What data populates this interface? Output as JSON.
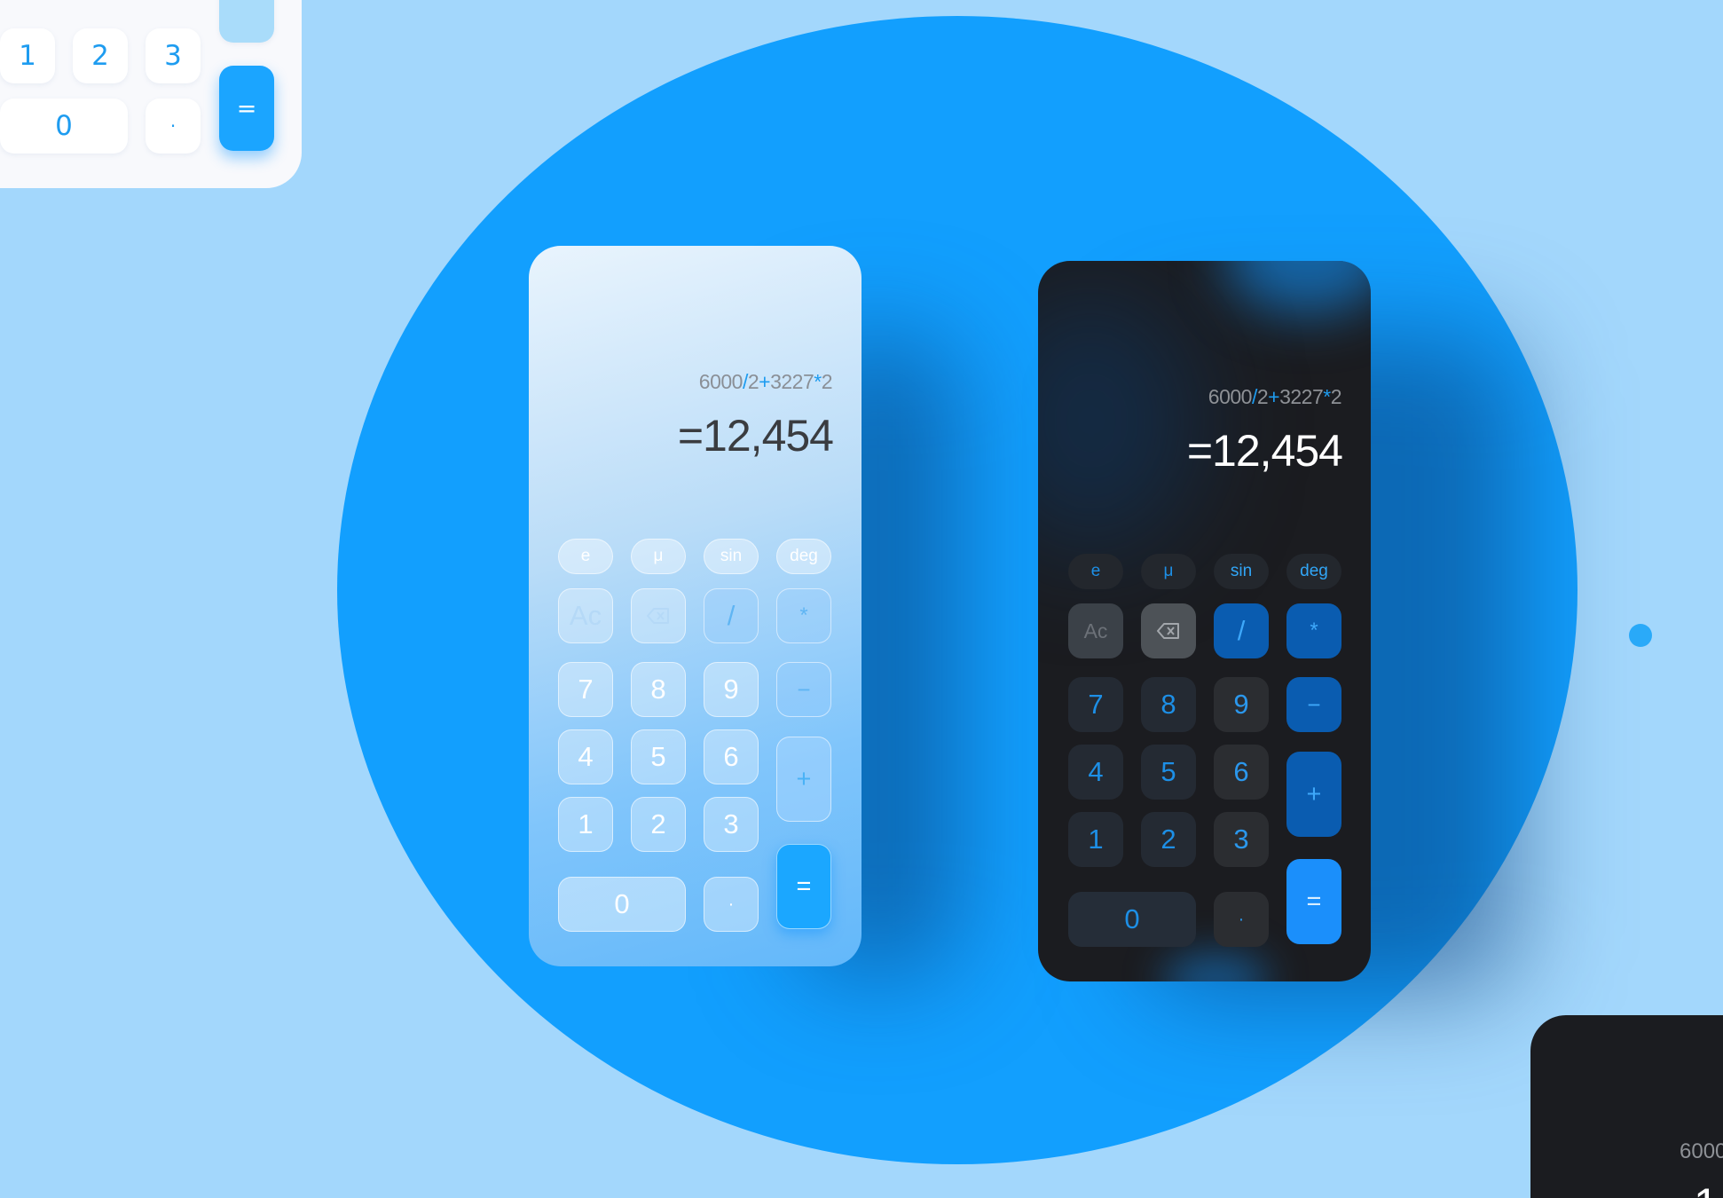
{
  "background_color": "#a3d7fc",
  "accent_color": "#129ffe",
  "top_left_calculator": {
    "keys": [
      "1",
      "2",
      "3",
      "0",
      "·",
      "+",
      "="
    ]
  },
  "light_calculator": {
    "expression": {
      "a": "6000",
      "op1": "/",
      "b": "2",
      "op2": "+",
      "c": "3227",
      "op3": "*",
      "d": "2"
    },
    "result": "=12,454",
    "functions": [
      "e",
      "μ",
      "sin",
      "deg"
    ],
    "controls": {
      "clear": "Ac",
      "backspace_icon": "backspace-icon",
      "divide": "/",
      "multiply": "*"
    },
    "keys": {
      "seven": "7",
      "eight": "8",
      "nine": "9",
      "minus": "−",
      "four": "4",
      "five": "5",
      "six": "6",
      "plus": "+",
      "one": "1",
      "two": "2",
      "three": "3",
      "zero": "0",
      "dot": "·",
      "equals": "="
    }
  },
  "dark_calculator": {
    "expression": {
      "a": "6000",
      "op1": "/",
      "b": "2",
      "op2": "+",
      "c": "3227",
      "op3": "*",
      "d": "2"
    },
    "result": "=12,454",
    "functions": [
      "e",
      "μ",
      "sin",
      "deg"
    ],
    "controls": {
      "clear": "Ac",
      "backspace_icon": "backspace-icon",
      "divide": "/",
      "multiply": "*"
    },
    "keys": {
      "seven": "7",
      "eight": "8",
      "nine": "9",
      "minus": "−",
      "four": "4",
      "five": "5",
      "six": "6",
      "plus": "+",
      "one": "1",
      "two": "2",
      "three": "3",
      "zero": "0",
      "dot": "·",
      "equals": "="
    }
  },
  "bottom_right_calculator": {
    "expression_fragment": "6000",
    "result_fragment": "1"
  }
}
